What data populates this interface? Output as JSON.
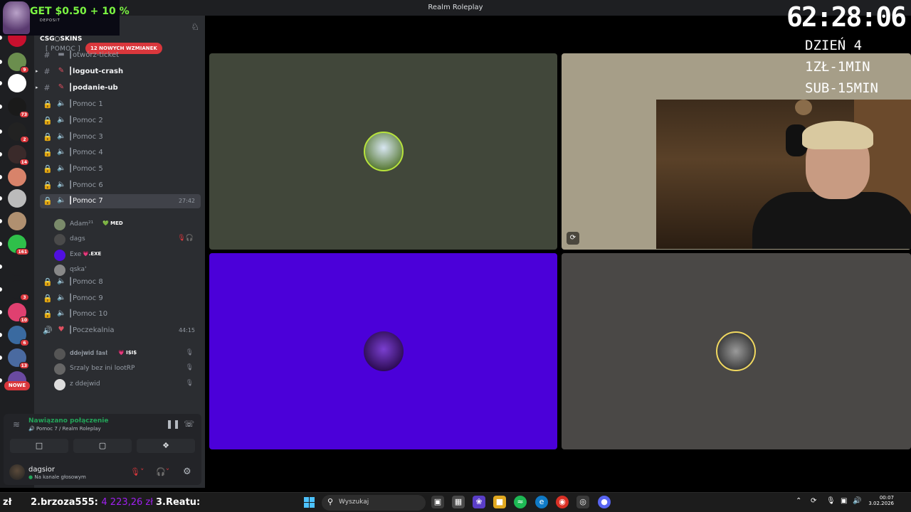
{
  "window": {
    "title": "Realm Roleplay"
  },
  "promo": {
    "text": "GET $0.50 + 10 %",
    "sub": "DEPOSIT",
    "brand": "CSG○SKINS"
  },
  "rail": {
    "servers": [
      {
        "icon": "b-server-icon",
        "badge": ""
      },
      {
        "icon": "server-avatar-icon",
        "badge": "9"
      },
      {
        "icon": "text-logo-server-icon",
        "badge": ""
      },
      {
        "icon": "palm-server-icon",
        "badge": "73"
      },
      {
        "icon": "z-server-icon",
        "badge": "2"
      },
      {
        "icon": "dark-server-icon",
        "badge": "14"
      },
      {
        "icon": "face-server-icon",
        "badge": ""
      },
      {
        "icon": "car-server-icon",
        "badge": ""
      },
      {
        "icon": "portrait-server-icon",
        "badge": ""
      },
      {
        "icon": "green-server-icon",
        "badge": "161"
      },
      {
        "icon": "g-server-icon",
        "badge": ""
      },
      {
        "icon": "hourglass-server-icon",
        "badge": "3"
      },
      {
        "icon": "heart-server-icon",
        "badge": "10"
      },
      {
        "icon": "city-server-icon",
        "badge": "6"
      },
      {
        "icon": "game-server-icon",
        "badge": "13"
      },
      {
        "icon": "purple-server-icon",
        "badge": ""
      }
    ],
    "new_label": "NOWE"
  },
  "sidebar": {
    "category": "[ POMOC ]",
    "mentions": "12 NOWYCH WZMIANEK",
    "channels": [
      {
        "name": "┃otwórz-ticket",
        "type": "text"
      },
      {
        "name": "┃logout-crash",
        "type": "text"
      },
      {
        "name": "┃podanie-ub",
        "type": "text"
      },
      {
        "name": "┃Pomoc 1",
        "type": "voice"
      },
      {
        "name": "┃Pomoc 2",
        "type": "voice"
      },
      {
        "name": "┃Pomoc 3",
        "type": "voice"
      },
      {
        "name": "┃Pomoc 4",
        "type": "voice"
      },
      {
        "name": "┃Pomoc 5",
        "type": "voice"
      },
      {
        "name": "┃Pomoc 6",
        "type": "voice"
      },
      {
        "name": "┃Pomoc 7",
        "type": "voice",
        "time": "27:42"
      },
      {
        "name": "┃Pomoc 8",
        "type": "voice"
      },
      {
        "name": "┃Pomoc 9",
        "type": "voice"
      },
      {
        "name": "┃Pomoc 10",
        "type": "voice"
      },
      {
        "name": "┃Poczekalnia",
        "type": "voice",
        "time": "44:15"
      }
    ],
    "pomoc7_users": [
      {
        "name": "Adam²¹",
        "tag": "💚 MED"
      },
      {
        "name": "dags",
        "tag": ""
      },
      {
        "name": "Exe",
        "tag": "💗.EXE"
      },
      {
        "name": "qska'",
        "tag": ""
      }
    ],
    "waiting_users": [
      {
        "name": "𝐝𝐝𝐞𝐣𝐰𝐢𝐝 𝐟𝐚𝐬𝐭",
        "tag": "💗 I$I$"
      },
      {
        "name": "Srzaly bez ini lootRP",
        "tag": ""
      },
      {
        "name": "z ddejwid",
        "tag": ""
      }
    ]
  },
  "voice": {
    "status": "Nawiązano połączenie",
    "location": "Pomoc 7 / Realm Roleplay"
  },
  "user": {
    "name": "dagsior",
    "status": "Na kanale głosowym"
  },
  "stage": {
    "colors": {
      "tile1": "#41473a",
      "tile2": "#a69e88",
      "tile3": "#4b00d9",
      "tile4": "#4a4846"
    }
  },
  "overlay": {
    "timer": "62:28:06",
    "day": "DZIEŃ 4",
    "rate1": "1ZŁ-1MIN",
    "rate2": "SUB-15MIN"
  },
  "taskbar": {
    "ticker": [
      {
        "rank": "zł",
        "amount": ""
      },
      {
        "rank": "2.brzoza555:",
        "amount": "4 223,26 zł"
      },
      {
        "rank": "3.Reatu:",
        "amount": ""
      }
    ],
    "search_placeholder": "Wyszukaj",
    "time": "00:07",
    "date": "3.02.2026"
  }
}
